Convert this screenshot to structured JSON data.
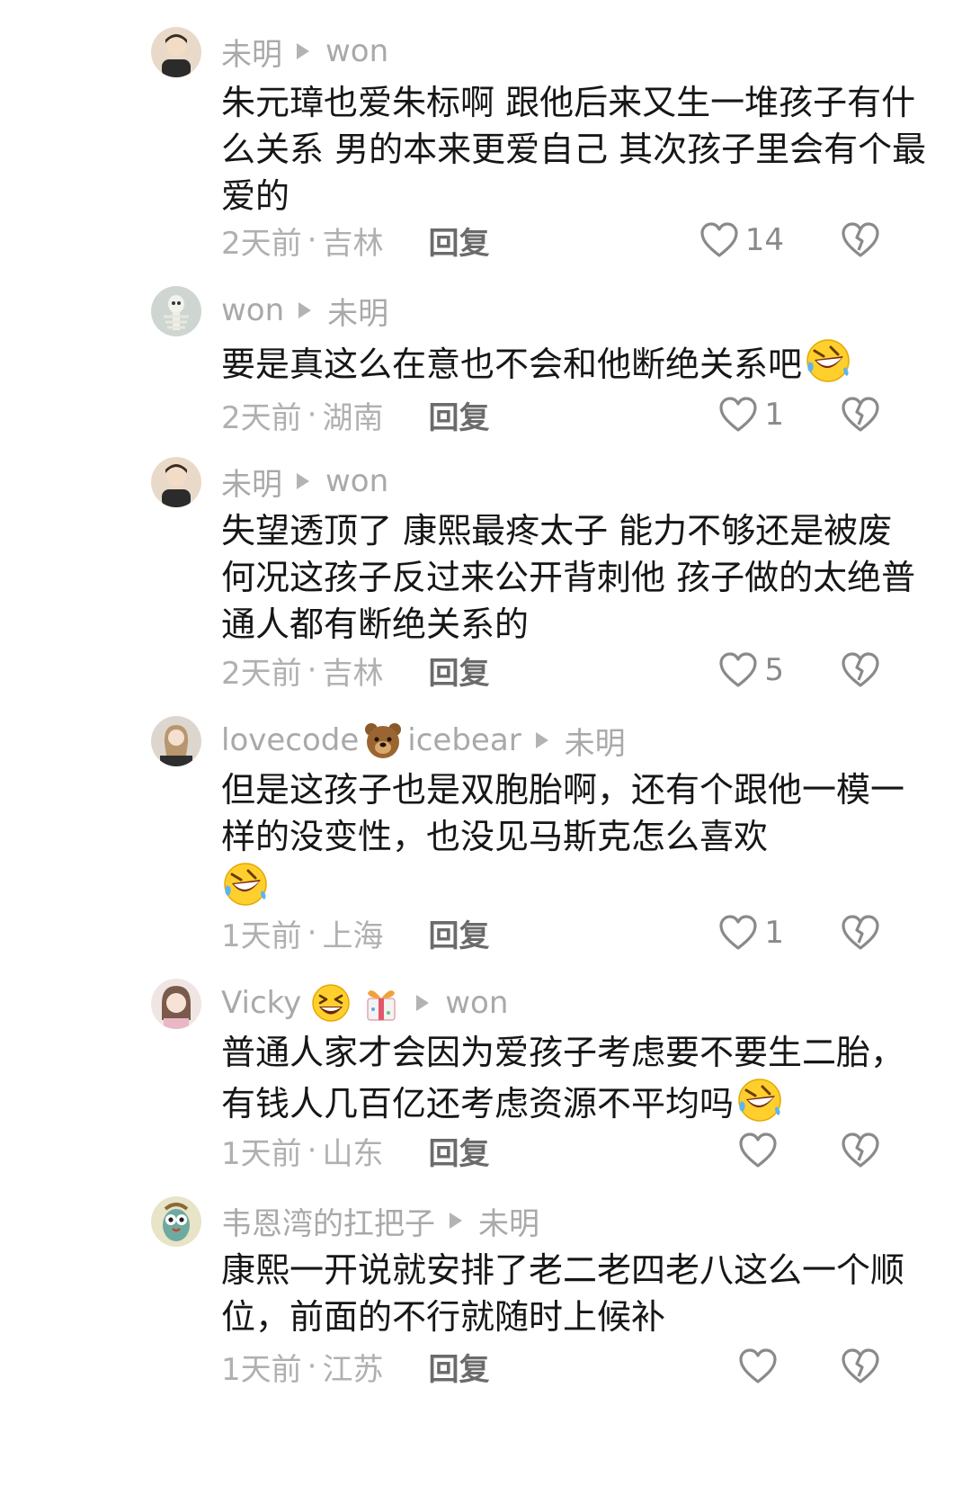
{
  "comments": [
    {
      "author": "未明",
      "reply_to": "won",
      "text": "朱元璋也爱朱标啊 跟他后来又生一堆孩子有什么关系 男的本来更爱自己 其次孩子里会有个最爱的",
      "time": "2天前",
      "location": "吉林",
      "reply_label": "回复",
      "likes": "14"
    },
    {
      "author": "won",
      "reply_to": "未明",
      "text": "要是真这么在意也不会和他断绝关系吧",
      "time": "2天前",
      "location": "湖南",
      "reply_label": "回复",
      "likes": "1"
    },
    {
      "author": "未明",
      "reply_to": "won",
      "text": "失望透顶了 康熙最疼太子 能力不够还是被废 何况这孩子反过来公开背刺他 孩子做的太绝普通人都有断绝关系的",
      "time": "2天前",
      "location": "吉林",
      "reply_label": "回复",
      "likes": "5"
    },
    {
      "author": "lovecode",
      "author_suffix": "icebear",
      "reply_to": "未明",
      "text": "但是这孩子也是双胞胎啊，还有个跟他一模一样的没变性，也没见马斯克怎么喜欢",
      "time": "1天前",
      "location": "上海",
      "reply_label": "回复",
      "likes": "1"
    },
    {
      "author": "Vicky",
      "reply_to": "won",
      "text": "普通人家才会因为爱孩子考虑要不要生二胎，有钱人几百亿还考虑资源不平均吗",
      "time": "1天前",
      "location": "山东",
      "reply_label": "回复",
      "likes": ""
    },
    {
      "author": "韦恩湾的扛把子",
      "reply_to": "未明",
      "text": "康熙一开说就安排了老二老四老八这么一个顺位，前面的不行就随时上候补",
      "time": "1天前",
      "location": "江苏",
      "reply_label": "回复",
      "likes": ""
    }
  ],
  "separator": "·",
  "icons": {
    "like": "heart-outline-icon",
    "dislike": "broken-heart-icon",
    "reply_arrow": "triangle-right-icon",
    "laugh": "rolling-laughing-emoji",
    "bear": "bear-face-emoji",
    "grin": "grinning-squint-emoji",
    "gift": "ribbon-gift-emoji"
  },
  "colors": {
    "text": "#161616",
    "meta": "#b0b0b0",
    "name": "#a9a9a9",
    "reply": "#6b6b6b"
  }
}
